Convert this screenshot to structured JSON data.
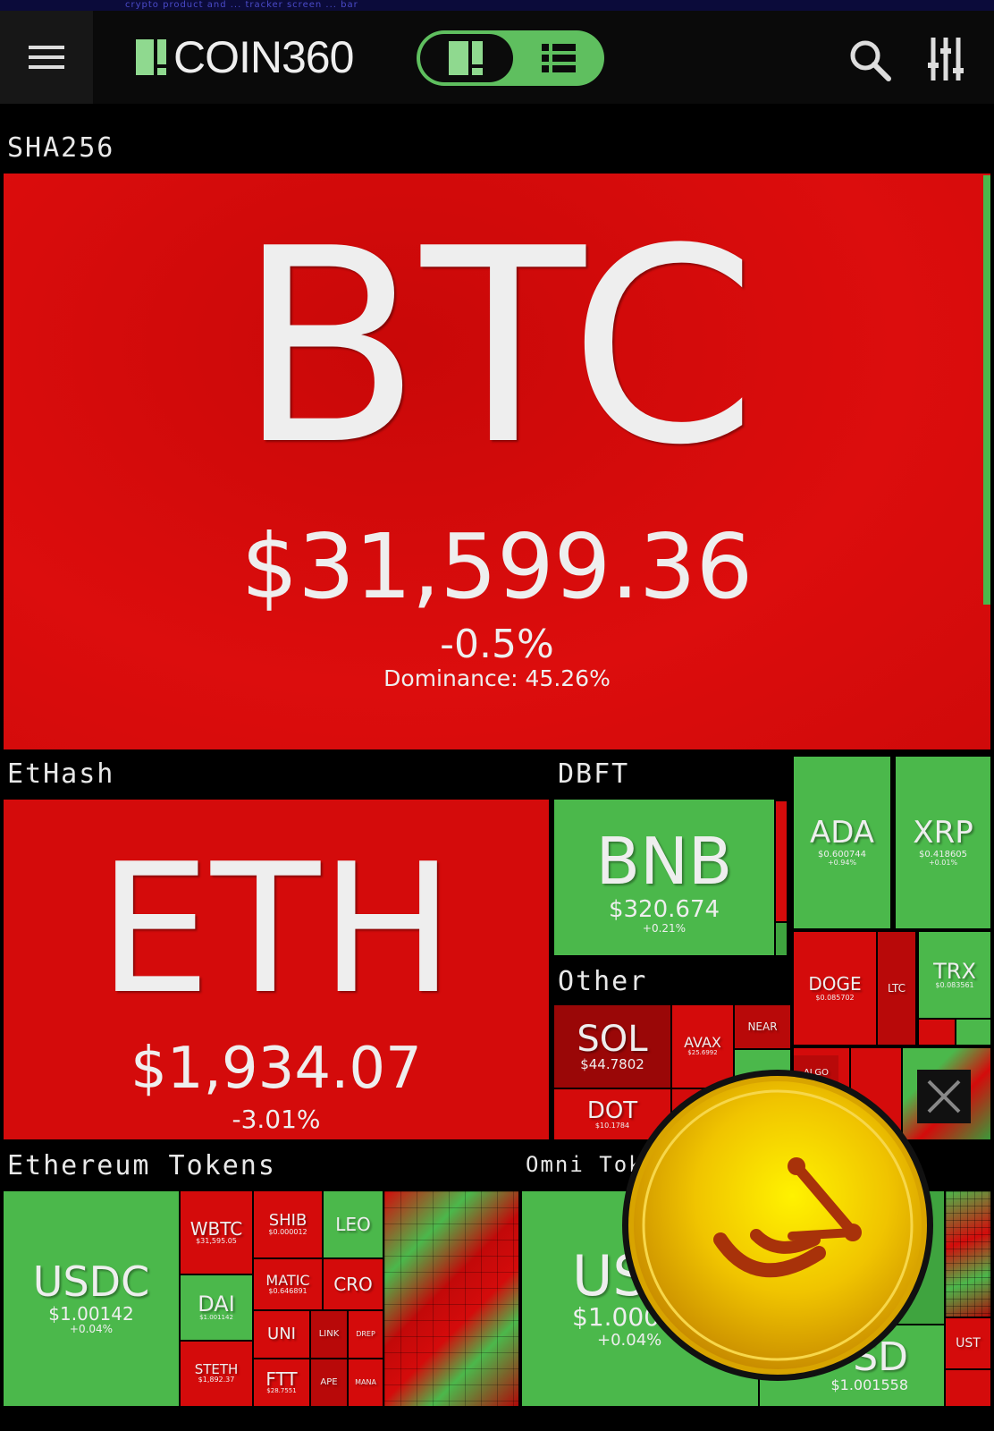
{
  "top_banner": "crypto product and ... tracker screen ... bar",
  "header": {
    "logo": "COIN360"
  },
  "icons": {
    "menu": "hamburger-menu-icon",
    "search": "search-icon",
    "filters": "sliders-icon",
    "treemap": "treemap-view-icon",
    "list": "list-view-icon",
    "close": "close-icon",
    "promo": "coin-promo-icon"
  },
  "colors": {
    "down": "#d40b0b",
    "up": "#4bb84b",
    "bg": "#000000",
    "accent": "#7fd47f"
  },
  "sections": {
    "sha256": "SHA256",
    "ethash": "EtHash",
    "dbft": "DBFT",
    "other": "Other",
    "eth_tokens": "Ethereum Tokens",
    "omni": "Omni Toke"
  },
  "coins": {
    "btc": {
      "symbol": "BTC",
      "price": "$31,599.36",
      "change": "-0.5%",
      "dominance": "Dominance: 45.26%"
    },
    "eth": {
      "symbol": "ETH",
      "price": "$1,934.07",
      "change": "-3.01%"
    },
    "bnb": {
      "symbol": "BNB",
      "price": "$320.674",
      "change": "+0.21%"
    },
    "ada": {
      "symbol": "ADA",
      "price": "$0.600744",
      "change": "+0.94%"
    },
    "xrp": {
      "symbol": "XRP",
      "price": "$0.418605",
      "change": "+0.01%"
    },
    "doge": {
      "symbol": "DOGE",
      "price": "$0.085702"
    },
    "ltc": {
      "symbol": "LTC"
    },
    "trx": {
      "symbol": "TRX",
      "price": "$0.083561"
    },
    "sol": {
      "symbol": "SOL",
      "price": "$44.7802"
    },
    "avax": {
      "symbol": "AVAX",
      "price": "$25.6992"
    },
    "near": {
      "symbol": "NEAR"
    },
    "dot": {
      "symbol": "DOT",
      "price": "$10.1784"
    },
    "algo": {
      "symbol": "ALGO"
    },
    "usdc": {
      "symbol": "USDC",
      "price": "$1.00142",
      "change": "+0.04%"
    },
    "wbtc": {
      "symbol": "WBTC",
      "price": "$31,595.05"
    },
    "shib": {
      "symbol": "SHIB",
      "price": "$0.000012"
    },
    "leo": {
      "symbol": "LEO"
    },
    "dai": {
      "symbol": "DAI",
      "price": "$1.001142"
    },
    "matic": {
      "symbol": "MATIC",
      "price": "$0.646891"
    },
    "cro": {
      "symbol": "CRO"
    },
    "uni": {
      "symbol": "UNI"
    },
    "link": {
      "symbol": "LINK"
    },
    "drep": {
      "symbol": "DREP"
    },
    "steth": {
      "symbol": "STETH",
      "price": "$1,892.37"
    },
    "ftt": {
      "symbol": "FTT",
      "price": "$28.7551"
    },
    "ape": {
      "symbol": "APE"
    },
    "mana": {
      "symbol": "MANA"
    },
    "usdt": {
      "symbol": "US",
      "price": "$1.000",
      "change": "+0.04%"
    },
    "busd": {
      "symbol": "SD",
      "price": "$1.001558"
    },
    "ust": {
      "symbol": "UST"
    }
  }
}
